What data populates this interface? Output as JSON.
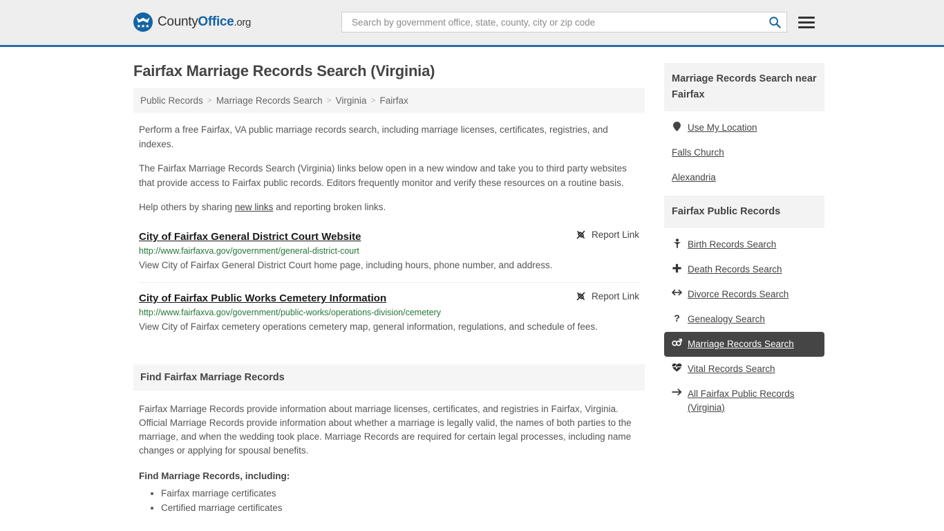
{
  "header": {
    "logo": {
      "county": "County",
      "office": "Office",
      "org": ".org",
      "stars": "★★★",
      "icon": "eagle-shield-logo"
    },
    "search": {
      "placeholder": "Search by government office, state, county, city or zip code",
      "value": "",
      "search_icon": "search-icon",
      "menu_icon": "hamburger-menu-icon"
    }
  },
  "main": {
    "title": "Fairfax Marriage Records Search (Virginia)",
    "breadcrumb": [
      {
        "label": "Public Records",
        "current": false
      },
      {
        "label": "Marriage Records Search",
        "current": false
      },
      {
        "label": "Virginia",
        "current": false
      },
      {
        "label": "Fairfax",
        "current": true
      }
    ],
    "breadcrumb_separator": ">",
    "intro": [
      "Perform a free Fairfax, VA public marriage records search, including marriage licenses, certificates, registries, and indexes.",
      "The Fairfax Marriage Records Search (Virginia) links below open in a new window and take you to third party websites that provide access to Fairfax public records. Editors frequently monitor and verify these resources on a routine basis."
    ],
    "help_prefix": "Help others by sharing ",
    "help_link": "new links",
    "help_suffix": " and reporting broken links.",
    "report_link_label": "Report Link",
    "report_link_icon": "unlink-icon",
    "results": [
      {
        "title": "City of Fairfax General District Court Website",
        "url": "http://www.fairfaxva.gov/government/general-district-court",
        "description": "View City of Fairfax General District Court home page, including hours, phone number, and address."
      },
      {
        "title": "City of Fairfax Public Works Cemetery Information",
        "url": "http://www.fairfaxva.gov/government/public-works/operations-division/cemetery",
        "description": "View City of Fairfax cemetery operations cemetery map, general information, regulations, and schedule of fees."
      }
    ],
    "section": {
      "heading": "Find Fairfax Marriage Records",
      "paragraph": "Fairfax Marriage Records provide information about marriage licenses, certificates, and registries in Fairfax, Virginia. Official Marriage Records provide information about whether a marriage is legally valid, the names of both parties to the marriage, and when the wedding took place. Marriage Records are required for certain legal processes, including name changes or applying for spousal benefits.",
      "list_heading": "Find Marriage Records, including:",
      "list_items": [
        "Fairfax marriage certificates",
        "Certified marriage certificates"
      ]
    }
  },
  "sidebar": {
    "near_card": {
      "heading": "Marriage Records Search near Fairfax",
      "items": [
        {
          "label": "Use My Location",
          "icon": "map-pin-icon",
          "active": false
        },
        {
          "label": "Falls Church",
          "icon": "",
          "active": false
        },
        {
          "label": "Alexandria",
          "icon": "",
          "active": false
        }
      ]
    },
    "records_card": {
      "heading": "Fairfax Public Records",
      "items": [
        {
          "label": "Birth Records Search",
          "icon": "baby-icon",
          "active": false
        },
        {
          "label": "Death Records Search",
          "icon": "cross-icon",
          "active": false
        },
        {
          "label": "Divorce Records Search",
          "icon": "arrows-left-right-icon",
          "active": false
        },
        {
          "label": "Genealogy Search",
          "icon": "question-mark-icon",
          "active": false
        },
        {
          "label": "Marriage Records Search",
          "icon": "venus-mars-icon",
          "active": true
        },
        {
          "label": "Vital Records Search",
          "icon": "heart-pulse-icon",
          "active": false
        },
        {
          "label": "All Fairfax Public Records (Virginia)",
          "icon": "arrow-right-icon",
          "active": false
        }
      ]
    }
  },
  "colors": {
    "header_bg": "#eeeeee",
    "header_border": "#2c6ca4",
    "brand_blue": "#1464a5",
    "url_green": "#27773a",
    "active_bg": "#454545",
    "panel_bg": "#f5f5f5"
  }
}
